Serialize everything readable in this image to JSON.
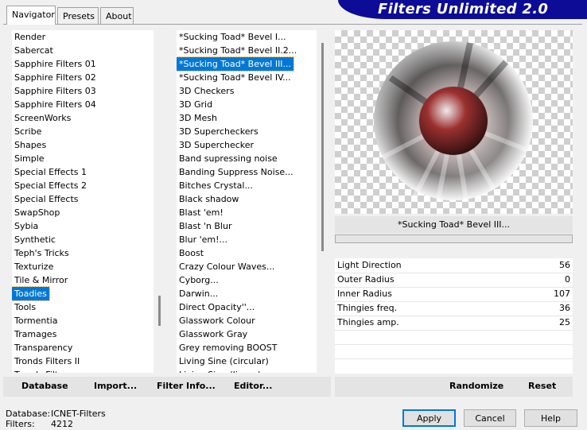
{
  "tabs": [
    {
      "label": "Navigator"
    },
    {
      "label": "Presets"
    },
    {
      "label": "About"
    }
  ],
  "banner": {
    "title": "Filters Unlimited 2.0"
  },
  "categories": [
    "Render",
    "Sabercat",
    "Sapphire Filters 01",
    "Sapphire Filters 02",
    "Sapphire Filters 03",
    "Sapphire Filters 04",
    "ScreenWorks",
    "Scribe",
    "Shapes",
    "Simple",
    "Special Effects 1",
    "Special Effects 2",
    "Special Effects",
    "SwapShop",
    "Sybia",
    "Synthetic",
    "Teph's Tricks",
    "Texturize",
    "Tile & Mirror",
    "Toadies",
    "Tools",
    "Tormentia",
    "Tramages",
    "Transparency",
    "Tronds Filters II",
    "Tronds Filters"
  ],
  "categories_selected": "Toadies",
  "filters": [
    "*Sucking Toad*  Bevel I...",
    "*Sucking Toad*  Bevel II.2...",
    "*Sucking Toad*  Bevel III...",
    "*Sucking Toad*  Bevel IV...",
    "3D Checkers",
    "3D Grid",
    "3D Mesh",
    "3D Supercheckers",
    "3D Superchecker",
    "Band supressing noise",
    "Banding Suppress Noise...",
    "Bitches Crystal...",
    "Black shadow",
    "Blast 'em!",
    "Blast 'n Blur",
    "Blur 'em!...",
    "Boost",
    "Crazy Colour Waves...",
    "Cyborg...",
    "Darwin...",
    "Direct Opacity''...",
    "Glasswork Colour",
    "Glasswork Gray",
    "Grey removing BOOST",
    "Living Sine (circular)",
    "Living Sine (linear)"
  ],
  "filters_selected": "*Sucking Toad*  Bevel III...",
  "current_filter": "*Sucking Toad*  Bevel III...",
  "parameters": [
    {
      "label": "Light Direction",
      "value": "56"
    },
    {
      "label": "Outer Radius",
      "value": "0"
    },
    {
      "label": "Inner Radius",
      "value": "107"
    },
    {
      "label": "Thingies freq.",
      "value": "36"
    },
    {
      "label": "Thingies amp.",
      "value": "25"
    }
  ],
  "toolbar": {
    "database": "Database",
    "import": "Import...",
    "filter_info": "Filter Info...",
    "editor": "Editor...",
    "randomize": "Randomize",
    "reset": "Reset"
  },
  "status": {
    "database_label": "Database:",
    "database_value": "ICNET-Filters",
    "filters_label": "Filters:",
    "filters_value": "4212"
  },
  "buttons": {
    "apply": "Apply",
    "cancel": "Cancel",
    "help": "Help"
  },
  "colors": {
    "accent": "#0078d7",
    "banner": "#0c0c96"
  }
}
